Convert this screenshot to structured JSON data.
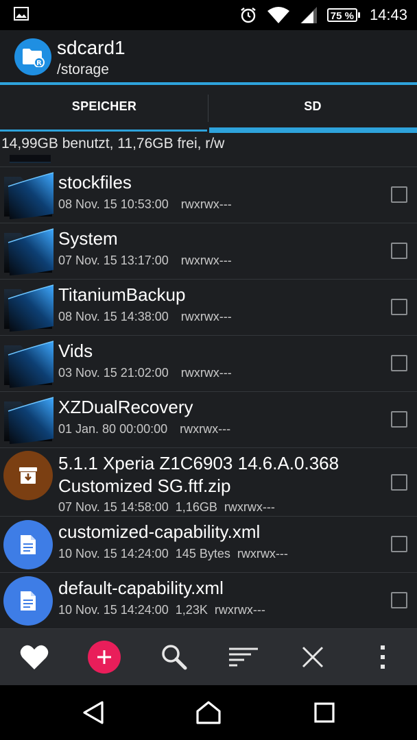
{
  "status_bar": {
    "battery": "75 %",
    "time": "14:43",
    "icons": [
      "image-icon",
      "alarm-icon",
      "wifi-icon",
      "signal-icon",
      "battery-icon"
    ]
  },
  "app_bar": {
    "title": "sdcard1",
    "subtitle": "/storage",
    "accent": "#2ea3dc",
    "avatar_color": "#1f8fe2"
  },
  "tabs": [
    {
      "label": "SPEICHER",
      "active": false
    },
    {
      "label": "SD",
      "active": true
    }
  ],
  "storage_info": "14,99GB benutzt, 11,76GB frei, r/w",
  "files": [
    {
      "name": "stockfiles",
      "date": "08 Nov. 15 10:53:00",
      "size": "",
      "perms": "rwxrwx---",
      "type": "folder"
    },
    {
      "name": "System",
      "date": "07 Nov. 15 13:17:00",
      "size": "",
      "perms": "rwxrwx---",
      "type": "folder"
    },
    {
      "name": "TitaniumBackup",
      "date": "08 Nov. 15 14:38:00",
      "size": "",
      "perms": "rwxrwx---",
      "type": "folder"
    },
    {
      "name": "Vids",
      "date": "03 Nov. 15 21:02:00",
      "size": "",
      "perms": "rwxrwx---",
      "type": "folder"
    },
    {
      "name": "XZDualRecovery",
      "date": "01 Jan. 80 00:00:00",
      "size": "",
      "perms": "rwxrwx---",
      "type": "folder"
    },
    {
      "name_line1": "5.1.1 Xperia Z1C6903 14.6.A.0.368",
      "name_line2": "Customized SG.ftf.zip",
      "date": "07 Nov. 15 14:58:00",
      "size": "1,16GB",
      "perms": "rwxrwx---",
      "type": "archive",
      "icon_color": "#7b3f12"
    },
    {
      "name": "customized-capability.xml",
      "date": "10 Nov. 15 14:24:00",
      "size": "145 Bytes",
      "perms": "rwxrwx---",
      "type": "document",
      "icon_color": "#3e7de6"
    },
    {
      "name": "default-capability.xml",
      "date": "10 Nov. 15 14:24:00",
      "size": "1,23K",
      "perms": "rwxrwx---",
      "type": "document",
      "icon_color": "#3e7de6"
    }
  ],
  "actions": [
    "heart-icon",
    "add-icon",
    "search-icon",
    "sort-icon",
    "close-icon",
    "more-vert-icon"
  ],
  "fab_color": "#e91e5a",
  "nav_buttons": [
    "back-icon",
    "home-icon",
    "recents-icon"
  ]
}
